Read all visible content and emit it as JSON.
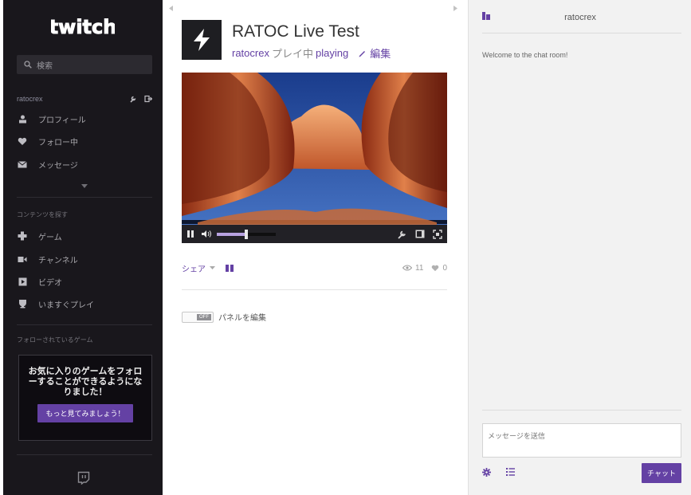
{
  "sidebar": {
    "logo_text": "twitch",
    "search_placeholder": "検索",
    "username": "ratocrex",
    "user_items": [
      {
        "label": "プロフィール",
        "icon": "person-icon"
      },
      {
        "label": "フォロー中",
        "icon": "heart-icon"
      },
      {
        "label": "メッセージ",
        "icon": "envelope-icon"
      }
    ],
    "browse_heading": "コンテンツを探す",
    "browse_items": [
      {
        "label": "ゲーム",
        "icon": "gamepad-icon"
      },
      {
        "label": "チャンネル",
        "icon": "camera-icon"
      },
      {
        "label": "ビデオ",
        "icon": "play-icon"
      },
      {
        "label": "いますぐプレイ",
        "icon": "trophy-icon"
      }
    ],
    "followed_heading": "フォローされているゲーム",
    "promo_text": "お気に入りのゲームをフォローすることができるようになりました！",
    "promo_button": "もっと見てみましょう！"
  },
  "channel": {
    "title": "RATOC Live Test",
    "owner": "ratocrex",
    "status_text": "プレイ中",
    "game": "playing",
    "edit_label": "編集",
    "volume_level": 0.5,
    "share_label": "シェア",
    "viewers": "11",
    "followers": "0",
    "panel_toggle_text": "OFF",
    "panel_label": "パネルを編集"
  },
  "chat": {
    "room_name": "ratocrex",
    "welcome": "Welcome to the chat room!",
    "input_placeholder": "メッセージを送信",
    "send_label": "チャット"
  },
  "colors": {
    "brand": "#6441a4",
    "sidebar_bg": "#19171c",
    "chat_bg": "#f2f2f2"
  }
}
